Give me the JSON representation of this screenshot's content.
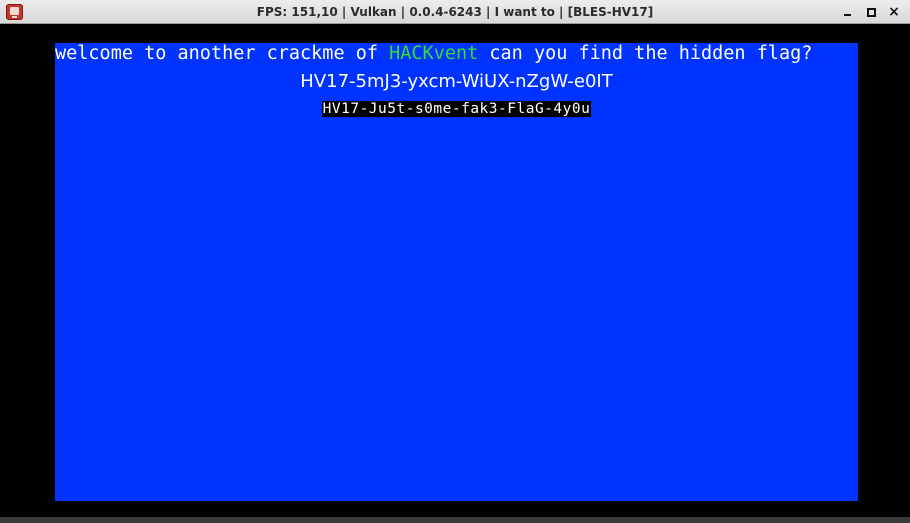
{
  "window": {
    "title": "FPS: 151,10 | Vulkan | 0.0.4-6243 | I want to  | [BLES-HV17]",
    "app_icon": "rpcs3-app-icon",
    "controls": {
      "minimize_icon": "minimize-icon",
      "maximize_icon": "maximize-icon",
      "close_glyph": "×"
    }
  },
  "game_screen": {
    "background_color": "#0033ff",
    "welcome_prefix": "welcome to another crackme of ",
    "welcome_highlight": "HACKvent",
    "welcome_suffix": " can you find the hidden flag?",
    "highlight_color": "#33dd33",
    "flag_line": "HV17-5mJ3-yxcm-WiUX-nZgW-e0IT",
    "fake_flag_line": "HV17-Ju5t-s0me-fak3-FlaG-4y0u"
  }
}
